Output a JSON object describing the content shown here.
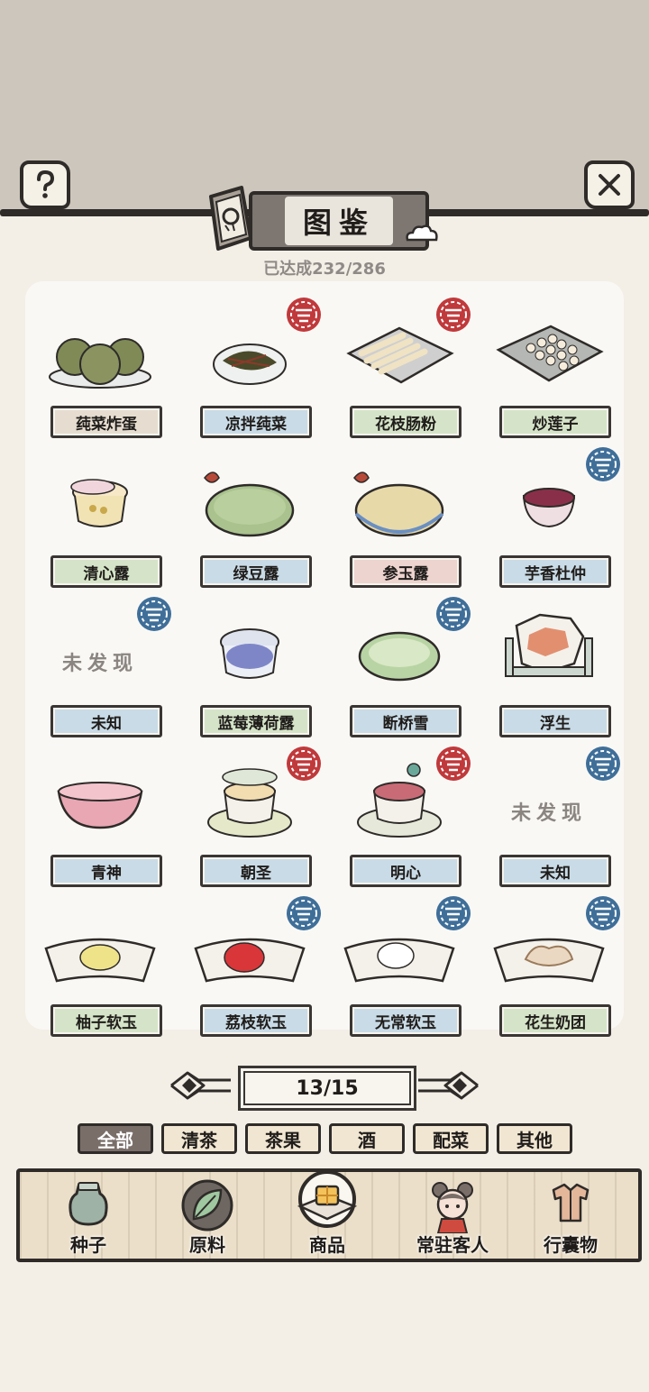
{
  "header": {
    "title": "图鉴",
    "progress": "已达成232/286",
    "help_icon": "question-mark-icon",
    "close_icon": "close-x-icon"
  },
  "grid": [
    {
      "name": "莼菜炸蛋",
      "label_color": "beige",
      "stamp": null,
      "dish": "fried-patties",
      "discovered": true
    },
    {
      "name": "凉拌莼菜",
      "label_color": "blue",
      "stamp": "red",
      "dish": "greens-bowl",
      "discovered": true
    },
    {
      "name": "花枝肠粉",
      "label_color": "green",
      "stamp": "red",
      "dish": "rice-rolls",
      "discovered": true
    },
    {
      "name": "炒莲子",
      "label_color": "green",
      "stamp": null,
      "dish": "lotus-seeds",
      "discovered": true
    },
    {
      "name": "清心露",
      "label_color": "green",
      "stamp": null,
      "dish": "clear-drink",
      "discovered": true
    },
    {
      "name": "绿豆露",
      "label_color": "blue",
      "stamp": null,
      "dish": "green-soup",
      "discovered": true
    },
    {
      "name": "参玉露",
      "label_color": "red",
      "stamp": null,
      "dish": "cream-soup",
      "discovered": true
    },
    {
      "name": "芋香杜仲",
      "label_color": "blue",
      "stamp": "blue",
      "dish": "purple-drink",
      "discovered": true
    },
    {
      "name": "未知",
      "label_color": "blue",
      "stamp": "blue",
      "dish": null,
      "discovered": false,
      "unknown_text": "未发现"
    },
    {
      "name": "蓝莓薄荷露",
      "label_color": "green",
      "stamp": null,
      "dish": "blueberry-cup",
      "discovered": true
    },
    {
      "name": "断桥雪",
      "label_color": "blue",
      "stamp": "blue",
      "dish": "green-bowl",
      "discovered": true
    },
    {
      "name": "浮生",
      "label_color": "blue",
      "stamp": null,
      "dish": "hex-jelly",
      "discovered": true
    },
    {
      "name": "青神",
      "label_color": "blue",
      "stamp": null,
      "dish": "pink-bowl",
      "discovered": true
    },
    {
      "name": "朝圣",
      "label_color": "blue",
      "stamp": "red",
      "dish": "tea-cup",
      "discovered": true
    },
    {
      "name": "明心",
      "label_color": "blue",
      "stamp": "red",
      "dish": "red-tea-cup",
      "discovered": true
    },
    {
      "name": "未知",
      "label_color": "blue",
      "stamp": "blue",
      "dish": null,
      "discovered": false,
      "unknown_text": "未发现"
    },
    {
      "name": "柚子软玉",
      "label_color": "green",
      "stamp": null,
      "dish": "yellow-jelly",
      "discovered": true
    },
    {
      "name": "荔枝软玉",
      "label_color": "blue",
      "stamp": "blue",
      "dish": "red-jelly",
      "discovered": true
    },
    {
      "name": "无常软玉",
      "label_color": "blue",
      "stamp": "blue",
      "dish": "white-jelly",
      "discovered": true
    },
    {
      "name": "花生奶团",
      "label_color": "green",
      "stamp": "blue",
      "dish": "peanut-cake",
      "discovered": true
    }
  ],
  "pager": {
    "text": "13/15",
    "prev_icon": "ornate-arrow-left-icon",
    "next_icon": "ornate-arrow-right-icon"
  },
  "tabs": [
    "全部",
    "清茶",
    "茶果",
    "酒",
    "配菜",
    "其他"
  ],
  "active_tab": 0,
  "bottom_nav": [
    {
      "label": "种子",
      "icon": "seed-jar-icon"
    },
    {
      "label": "原料",
      "icon": "leaf-icon"
    },
    {
      "label": "商品",
      "icon": "tofu-plate-icon"
    },
    {
      "label": "常驻客人",
      "icon": "girl-avatar-icon"
    },
    {
      "label": "行囊物",
      "icon": "robe-icon"
    }
  ],
  "colors": {
    "accent_ink": "#2e2b29",
    "stamp_red": "#c0393b",
    "stamp_blue": "#3f6f99",
    "active_tab": "#7a6e69"
  }
}
